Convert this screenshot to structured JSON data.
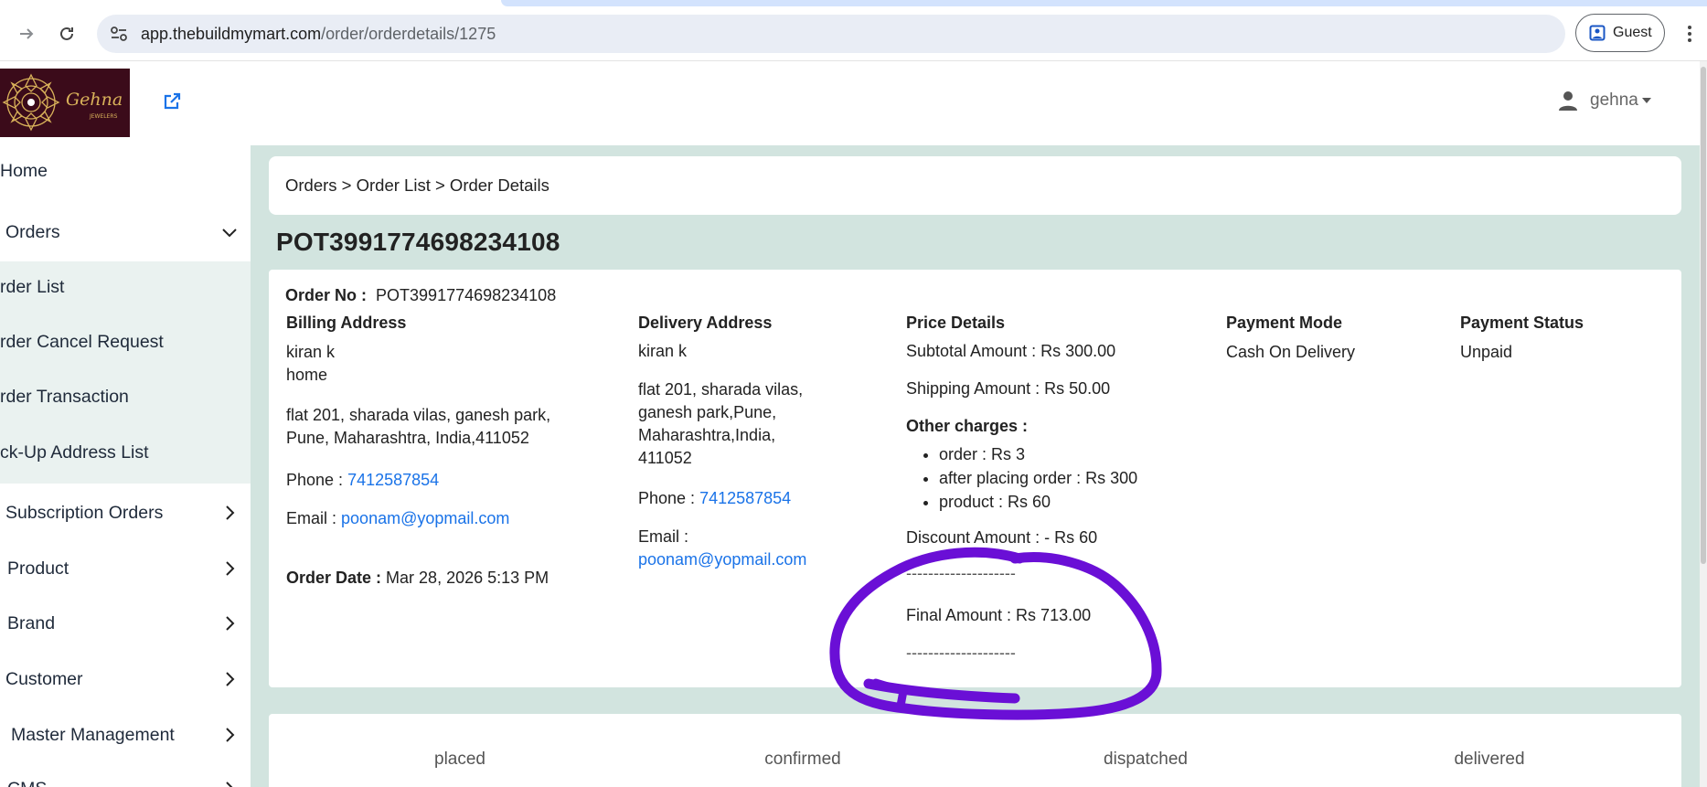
{
  "browser": {
    "url_host": "app.thebuildmymart.com",
    "url_path": "/order/orderdetails/1275",
    "profile_label": "Guest"
  },
  "header": {
    "logo_text": "Gehna",
    "logo_subtext": "JEWELERS",
    "user_name": "gehna"
  },
  "sidebar": {
    "items": [
      {
        "label": "Home"
      },
      {
        "label": "Orders"
      },
      {
        "label": "rder List"
      },
      {
        "label": "rder Cancel Request"
      },
      {
        "label": "rder Transaction"
      },
      {
        "label": "ck-Up Address List"
      },
      {
        "label": "Subscription Orders"
      },
      {
        "label": "Product"
      },
      {
        "label": "Brand"
      },
      {
        "label": "Customer"
      },
      {
        "label": "Master Management"
      },
      {
        "label": "CMS"
      }
    ]
  },
  "breadcrumb": "Orders > Order List > Order Details",
  "order": {
    "title": "POT3991774698234108",
    "order_no_label": "Order No :",
    "order_no": "POT3991774698234108",
    "billing": {
      "heading": "Billing Address",
      "name": "kiran k",
      "type": "home",
      "address_line1": "flat 201, sharada vilas, ganesh park,",
      "address_line2": "Pune, Maharashtra, India,411052",
      "phone_label": "Phone :",
      "phone": "7412587854",
      "email_label": "Email :",
      "email": "poonam@yopmail.com",
      "date_label": "Order Date :",
      "date": "Mar 28, 2026 5:13 PM"
    },
    "delivery": {
      "heading": "Delivery Address",
      "name": "kiran k",
      "address_line1": "flat 201, sharada vilas,",
      "address_line2": "ganesh park,Pune,",
      "address_line3": "Maharashtra,India,",
      "address_line4": "411052",
      "phone_label": "Phone :",
      "phone": "7412587854",
      "email_label": "Email :",
      "email": "poonam@yopmail.com"
    },
    "price": {
      "heading": "Price Details",
      "subtotal": "Subtotal Amount : Rs 300.00",
      "shipping": "Shipping Amount : Rs 50.00",
      "other_heading": "Other charges :",
      "charges": [
        "order : Rs 3",
        "after placing order : Rs 300",
        "product : Rs 60"
      ],
      "discount": "Discount Amount : - Rs 60",
      "divider": "--------------------",
      "final": "Final Amount : Rs 713.00"
    },
    "payment_mode": {
      "heading": "Payment Mode",
      "value": "Cash On Delivery"
    },
    "payment_status": {
      "heading": "Payment Status",
      "value": "Unpaid"
    }
  },
  "status_steps": [
    "placed",
    "confirmed",
    "dispatched",
    "delivered"
  ],
  "colors": {
    "main_bg": "#d2e4df",
    "link": "#1a73e8",
    "annotation": "#6a0fd6",
    "logo_bg": "#3b0b1a"
  }
}
